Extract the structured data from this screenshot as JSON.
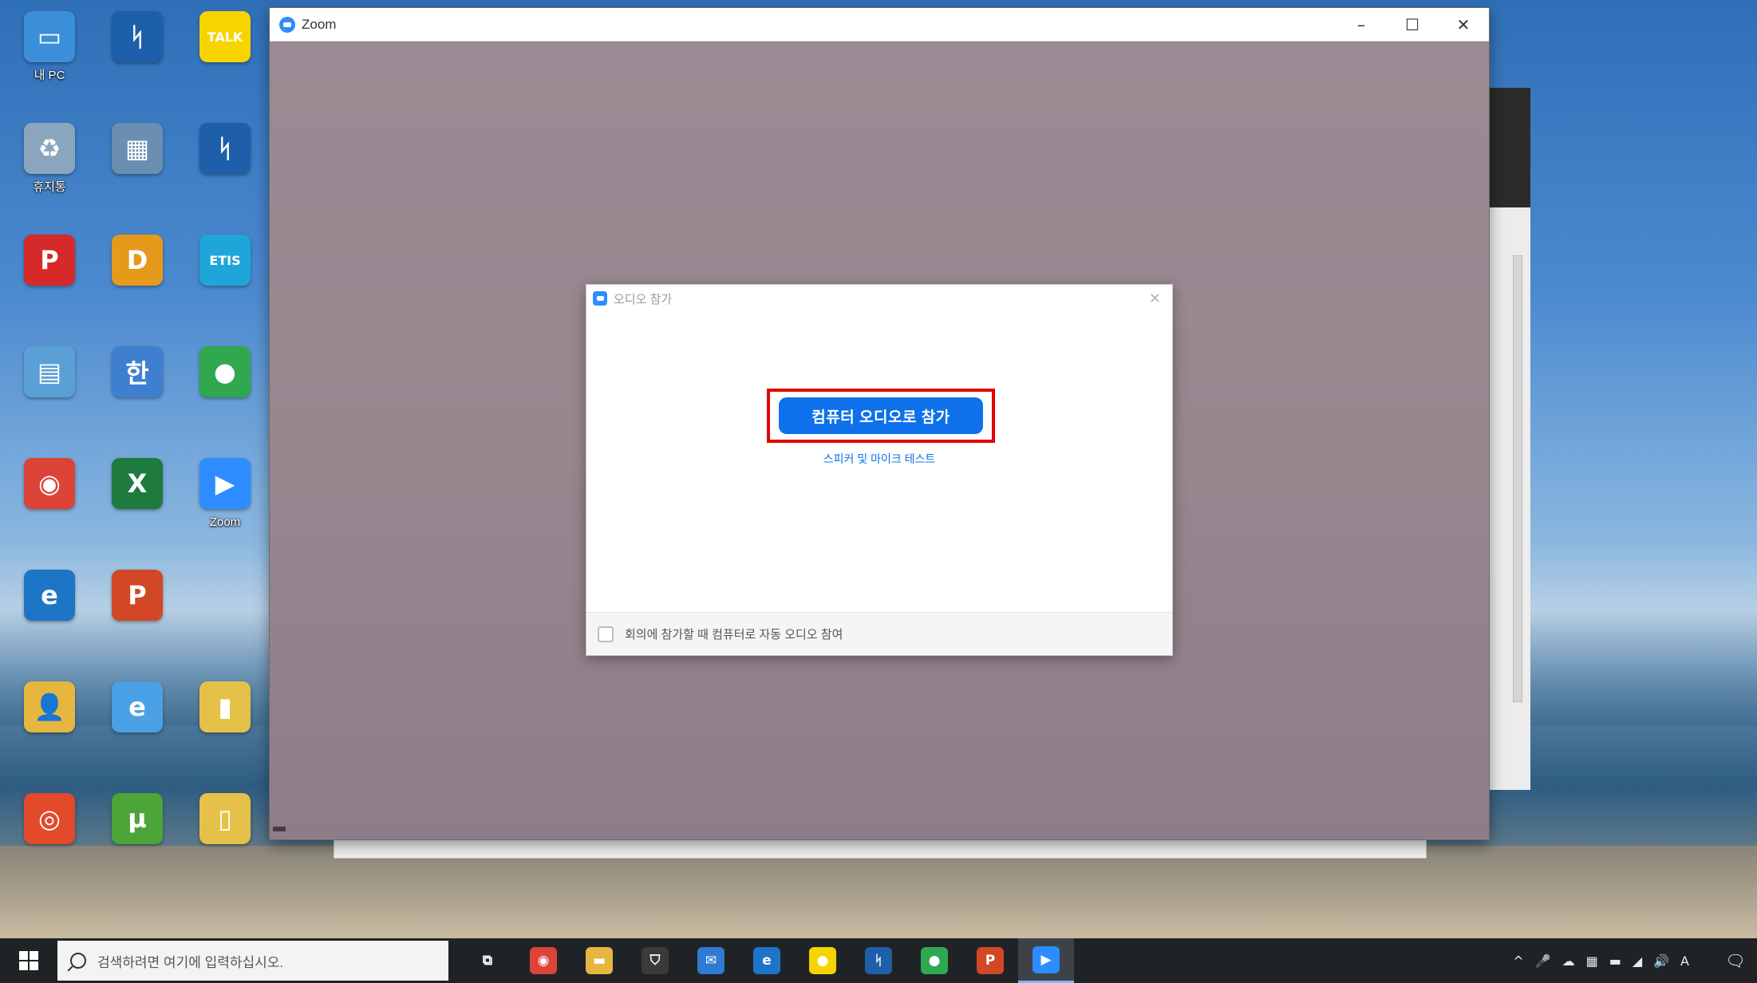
{
  "desktop": {
    "icons": [
      {
        "name": "pc-icon",
        "label": "내 PC",
        "glyph": "▭",
        "color": "#3b8fd9"
      },
      {
        "name": "app-icon",
        "label": "",
        "glyph": "ᛋ",
        "color": "#1d5fa8"
      },
      {
        "name": "kakaotalk-icon",
        "label": "",
        "glyph": "TALK",
        "color": "#f7d400"
      },
      {
        "name": "recycle-bin-icon",
        "label": "휴지통",
        "glyph": "♻",
        "color": "#8aa6bf"
      },
      {
        "name": "program-icon",
        "label": "",
        "glyph": "▦",
        "color": "#6b8fb0"
      },
      {
        "name": "app-icon-2",
        "label": "",
        "glyph": "ᛋ",
        "color": "#1d5fa8"
      },
      {
        "name": "hangul-viewer-icon",
        "label": "",
        "glyph": "P",
        "color": "#d62a2a"
      },
      {
        "name": "document-icon",
        "label": "",
        "glyph": "D",
        "color": "#e59a1b"
      },
      {
        "name": "etis-icon",
        "label": "",
        "glyph": "ETIS",
        "color": "#1fa6d8"
      },
      {
        "name": "folder-icon",
        "label": "",
        "glyph": "▤",
        "color": "#5aa0d6"
      },
      {
        "name": "hancom-icon",
        "label": "",
        "glyph": "한",
        "color": "#3f7fd0"
      },
      {
        "name": "app-icon-3",
        "label": "",
        "glyph": "●",
        "color": "#2fa84f"
      },
      {
        "name": "chrome-icon",
        "label": "",
        "glyph": "◉",
        "color": "#db4437"
      },
      {
        "name": "excel-icon",
        "label": "",
        "glyph": "X",
        "color": "#1f7a3f"
      },
      {
        "name": "zoom-icon",
        "label": "Zoom",
        "glyph": "▶",
        "color": "#2d8cff"
      },
      {
        "name": "edge-icon",
        "label": "",
        "glyph": "e",
        "color": "#1e74c7"
      },
      {
        "name": "powerpoint-icon",
        "label": "",
        "glyph": "P",
        "color": "#d24726"
      },
      {
        "name": "empty-slot",
        "label": "",
        "glyph": "",
        "color": "transparent"
      },
      {
        "name": "user-folder-icon",
        "label": "",
        "glyph": "👤",
        "color": "#e6b640"
      },
      {
        "name": "internet-shortcut-icon",
        "label": "",
        "glyph": "e",
        "color": "#4aa1e6"
      },
      {
        "name": "folder-icon-2",
        "label": "",
        "glyph": "▮",
        "color": "#e6c14a"
      },
      {
        "name": "gom-player-icon",
        "label": "",
        "glyph": "◎",
        "color": "#e24a2a"
      },
      {
        "name": "utorrent-icon",
        "label": "",
        "glyph": "µ",
        "color": "#4da53a"
      },
      {
        "name": "archive-icon",
        "label": "",
        "glyph": "▯",
        "color": "#e6c14a"
      }
    ]
  },
  "zoom_window": {
    "title": "Zoom",
    "minimize": "–",
    "maximize": "☐",
    "close": "✕",
    "name_chip": "",
    "background_color": "#9a8893"
  },
  "audio_dialog": {
    "title": "오디오 참가",
    "close": "✕",
    "join_button": "컴퓨터 오디오로 참가",
    "test_link": "스피커 및 마이크 테스트",
    "auto_join_label": "회의에 참가할 때 컴퓨터로 자동 오디오 참여",
    "auto_join_checked": false,
    "highlight_color": "#e30000",
    "button_color": "#0e71eb"
  },
  "taskbar": {
    "search_placeholder": "검색하려면 여기에 입력하십시오.",
    "apps": [
      {
        "name": "task-view-icon",
        "glyph": "⧉",
        "color": "transparent",
        "active": false
      },
      {
        "name": "chrome-taskbar-icon",
        "glyph": "◉",
        "color": "#db4437",
        "active": false
      },
      {
        "name": "file-explorer-icon",
        "glyph": "▬",
        "color": "#e6b640",
        "active": false
      },
      {
        "name": "store-icon",
        "glyph": "⛉",
        "color": "#3a3a3a",
        "active": false
      },
      {
        "name": "mail-icon",
        "glyph": "✉",
        "color": "#2e7bd1",
        "active": false
      },
      {
        "name": "edge-taskbar-icon",
        "glyph": "e",
        "color": "#1e74c7",
        "active": false
      },
      {
        "name": "kakaotalk-taskbar-icon",
        "glyph": "●",
        "color": "#f7d400",
        "active": false
      },
      {
        "name": "app-taskbar-icon",
        "glyph": "ᛋ",
        "color": "#1d5fa8",
        "active": false
      },
      {
        "name": "app-taskbar-icon-2",
        "glyph": "●",
        "color": "#2fa84f",
        "active": false
      },
      {
        "name": "powerpoint-taskbar-icon",
        "glyph": "P",
        "color": "#d24726",
        "active": false
      },
      {
        "name": "zoom-taskbar-icon",
        "glyph": "▶",
        "color": "#2d8cff",
        "active": true
      }
    ],
    "tray_glyphs": [
      "^",
      "🎤",
      "☁",
      "▦",
      "▬",
      "◢",
      "🔊",
      "A"
    ],
    "clock_time": "",
    "clock_date": "",
    "notifications": "🗨"
  }
}
